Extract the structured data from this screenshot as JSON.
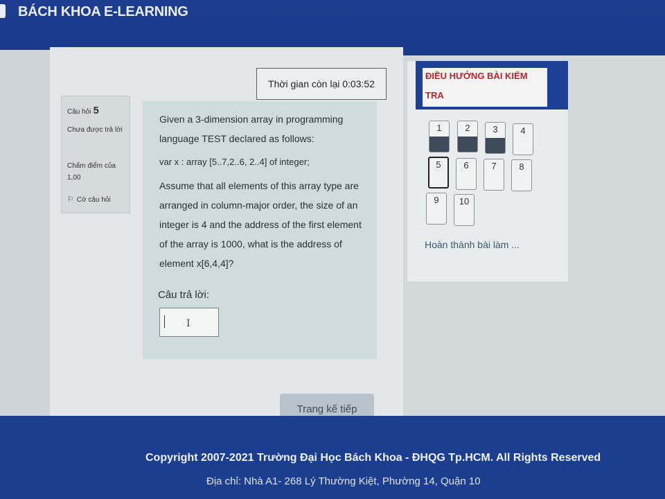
{
  "header": {
    "brand": "BÁCH KHOA E-LEARNING"
  },
  "timer": {
    "label": "Thời gian còn lại 0:03:52"
  },
  "question_info": {
    "label": "Câu hỏi",
    "number": "5",
    "status": "Chưa được trả lời",
    "grade": "Chấm điểm của 1,00",
    "flag": "Cờ câu hỏi"
  },
  "question": {
    "text1": "Given a 3-dimension array in programming language TEST declared as follows:",
    "code": "var x : array [5..7,2..6, 2..4] of integer;",
    "text2": "Assume that all elements of this array type are arranged in column-major order, the size of an integer is 4 and the address of the first element of the array is 1000, what is the address of element x[6,4,4]?",
    "answer_label": "Câu trả lời:",
    "answer_value": ""
  },
  "navigation": {
    "title_line1": "ĐIỀU HƯỚNG BÀI KIỂM",
    "title_line2": "TRA",
    "buttons": [
      {
        "label": "1",
        "answered": true
      },
      {
        "label": "2",
        "answered": true
      },
      {
        "label": "3",
        "answered": true
      },
      {
        "label": "4",
        "answered": false
      },
      {
        "label": "5",
        "answered": false,
        "current": true
      },
      {
        "label": "6",
        "answered": false
      },
      {
        "label": "7",
        "answered": false
      },
      {
        "label": "8",
        "answered": false
      },
      {
        "label": "9",
        "answered": false
      },
      {
        "label": "10",
        "answered": false
      }
    ],
    "finish": "Hoàn thành bài làm ..."
  },
  "next_button": "Trang kế tiếp",
  "footer": {
    "copyright": "Copyright 2007-2021 Trường Đại Học Bách Khoa - ĐHQG Tp.HCM. All Rights Reserved",
    "address": "Địa chỉ: Nhà A1- 268 Lý Thường Kiệt, Phường 14, Quận 10"
  }
}
